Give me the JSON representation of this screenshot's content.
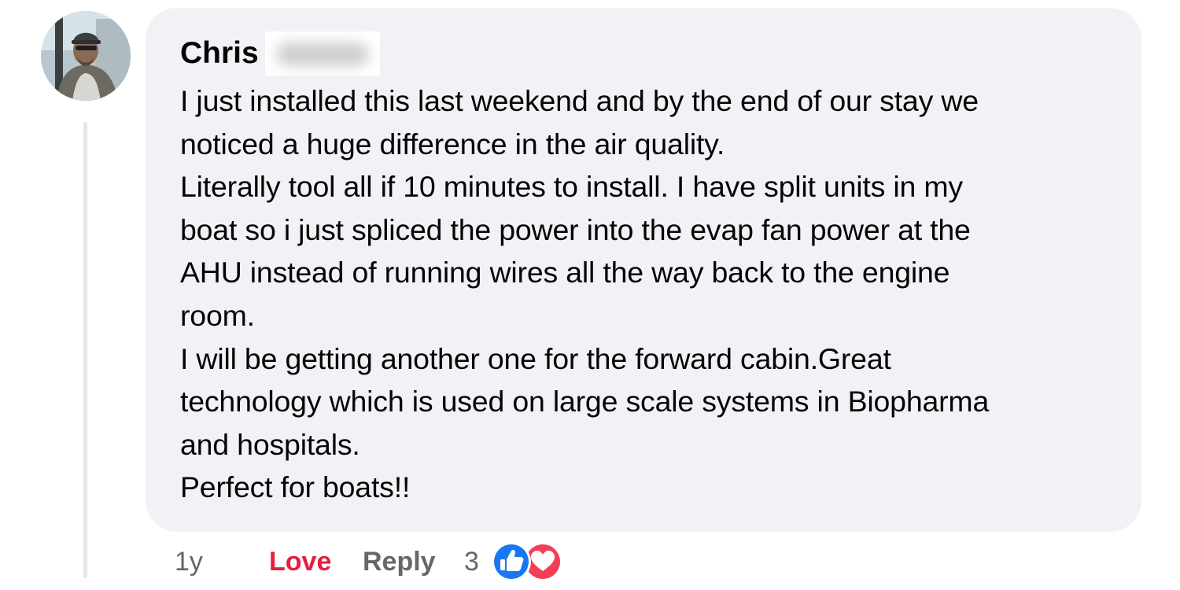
{
  "comment": {
    "author_first_name": "Chris",
    "author_surname_redacted": true,
    "body_lines": [
      "I just installed this last weekend and by the end of our stay we",
      "noticed a huge difference in the air quality.",
      "Literally tool all if 10 minutes to install. I have split units in my",
      "boat so i just spliced the power into the evap fan power at the",
      "AHU instead of running wires all the way back to the engine",
      "room.",
      "I will be getting another one for the forward cabin.Great",
      "technology which is used on large scale systems in Biopharma",
      "and hospitals.",
      "Perfect for boats!!"
    ]
  },
  "actions": {
    "time": "1y",
    "love_label": "Love",
    "reply_label": "Reply",
    "reaction_count": "3",
    "reaction_icons": [
      "like-icon",
      "love-icon"
    ]
  },
  "colors": {
    "bubble_bg": "#f0f2f5",
    "love_red": "#e41e3f",
    "like_blue": "#1877f2",
    "muted_text": "#65676b"
  }
}
